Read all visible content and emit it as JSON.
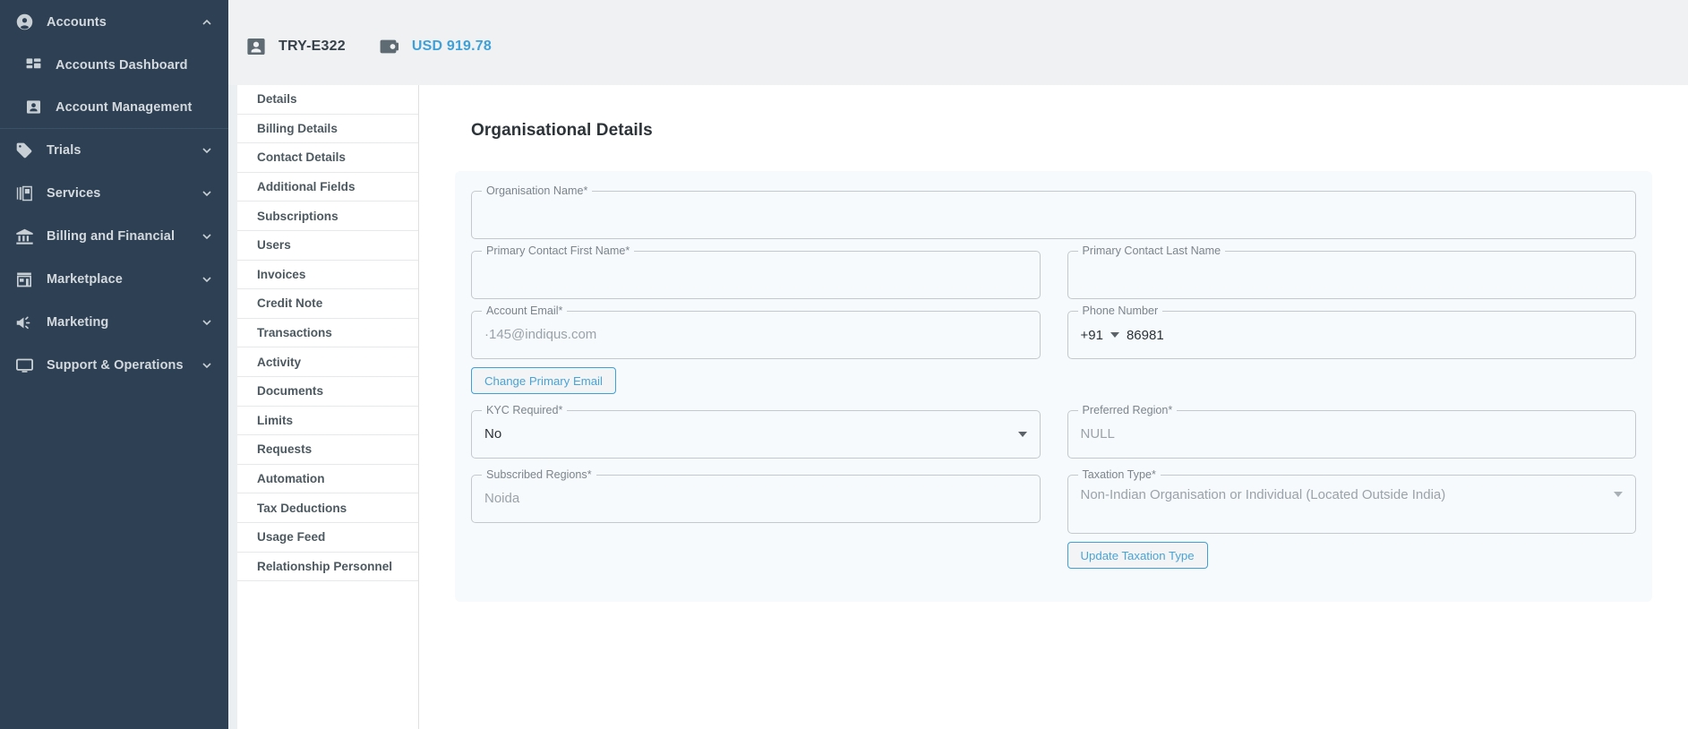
{
  "sidebar": {
    "groups": [
      {
        "label": "Accounts",
        "icon": "account-circle-icon",
        "expanded": true,
        "chevron": "chevron-up-icon",
        "children": [
          {
            "label": "Accounts Dashboard",
            "icon": "dashboard-icon"
          },
          {
            "label": "Account Management",
            "icon": "user-card-icon"
          }
        ]
      },
      {
        "label": "Trials",
        "icon": "tag-icon",
        "expanded": false,
        "chevron": "chevron-down-icon",
        "children": []
      },
      {
        "label": "Services",
        "icon": "layers-icon",
        "expanded": false,
        "chevron": "chevron-down-icon",
        "children": []
      },
      {
        "label": "Billing and Financial",
        "icon": "bank-icon",
        "expanded": false,
        "chevron": "chevron-down-icon",
        "children": []
      },
      {
        "label": "Marketplace",
        "icon": "store-icon",
        "expanded": false,
        "chevron": "chevron-down-icon",
        "children": []
      },
      {
        "label": "Marketing",
        "icon": "megaphone-icon",
        "expanded": false,
        "chevron": "chevron-down-icon",
        "children": []
      },
      {
        "label": "Support & Operations",
        "icon": "monitor-icon",
        "expanded": false,
        "chevron": "chevron-down-icon",
        "children": []
      }
    ]
  },
  "header": {
    "account_icon": "user-card-icon",
    "account_id": "TRY-E322",
    "wallet_icon": "wallet-icon",
    "balance": "USD 919.78",
    "balance_color": "#3fa0d8"
  },
  "subnav": {
    "items": [
      {
        "label": "Details",
        "active": true
      },
      {
        "label": "Billing Details",
        "active": false
      },
      {
        "label": "Contact Details",
        "active": false
      },
      {
        "label": "Additional Fields",
        "active": false
      },
      {
        "label": "Subscriptions",
        "active": false
      },
      {
        "label": "Users",
        "active": false
      },
      {
        "label": "Invoices",
        "active": false
      },
      {
        "label": "Credit Note",
        "active": false
      },
      {
        "label": "Transactions",
        "active": false
      },
      {
        "label": "Activity",
        "active": false
      },
      {
        "label": "Documents",
        "active": false
      },
      {
        "label": "Limits",
        "active": false
      },
      {
        "label": "Requests",
        "active": false
      },
      {
        "label": "Automation",
        "active": false
      },
      {
        "label": "Tax Deductions",
        "active": false
      },
      {
        "label": "Usage Feed",
        "active": false
      },
      {
        "label": "Relationship Personnel",
        "active": false
      }
    ]
  },
  "form": {
    "title": "Organisational Details",
    "organisation_name": {
      "label": "Organisation Name*",
      "value": ""
    },
    "primary_contact_first_name": {
      "label": "Primary Contact First Name*",
      "value": ""
    },
    "primary_contact_last_name": {
      "label": "Primary Contact Last Name",
      "value": ""
    },
    "account_email": {
      "label": "Account Email*",
      "value": "·145@indiqus.com"
    },
    "change_primary_email_button": "Change Primary Email",
    "phone_number": {
      "label": "Phone Number",
      "country_code": "+91",
      "value": "86981",
      "caret": "chevron-down-icon"
    },
    "kyc_required": {
      "label": "KYC Required*",
      "value": "No",
      "caret": "chevron-down-icon"
    },
    "preferred_region": {
      "label": "Preferred Region*",
      "value": "NULL"
    },
    "subscribed_regions": {
      "label": "Subscribed Regions*",
      "value": "Noida"
    },
    "taxation_type": {
      "label": "Taxation Type*",
      "value": "Non-Indian Organisation or Individual (Located Outside India)",
      "caret": "chevron-down-icon"
    },
    "update_taxation_type_button": "Update Taxation Type"
  },
  "colors": {
    "sidebar_bg": "#2e4053",
    "accent": "#3fa0d8",
    "card_bg": "#f7fafd"
  }
}
